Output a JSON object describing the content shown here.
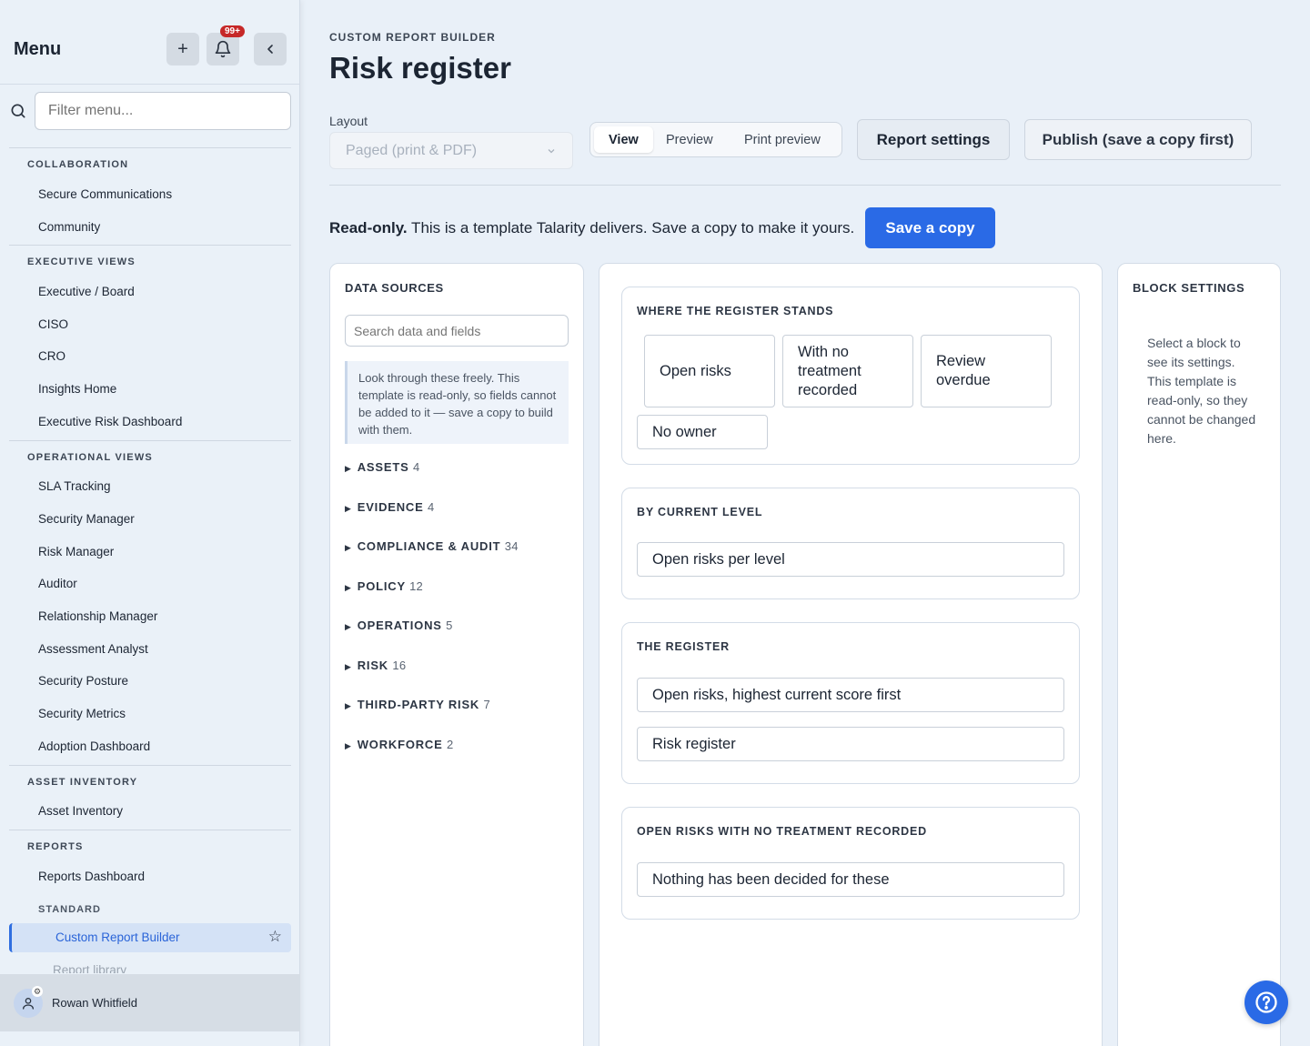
{
  "sidebar": {
    "title": "Menu",
    "notification_count": "99+",
    "filter_placeholder": "Filter menu...",
    "sections": {
      "collaboration": {
        "label": "COLLABORATION",
        "items": [
          "Secure Communications",
          "Community"
        ]
      },
      "executive": {
        "label": "EXECUTIVE VIEWS",
        "items": [
          "Executive / Board",
          "CISO",
          "CRO",
          "Insights Home",
          "Executive Risk Dashboard"
        ]
      },
      "operational": {
        "label": "OPERATIONAL VIEWS",
        "items": [
          "SLA Tracking",
          "Security Manager",
          "Risk Manager",
          "Auditor",
          "Relationship Manager",
          "Assessment Analyst",
          "Security Posture",
          "Security Metrics",
          "Adoption Dashboard"
        ]
      },
      "asset": {
        "label": "ASSET INVENTORY",
        "items": [
          "Asset Inventory"
        ]
      },
      "reports": {
        "label": "REPORTS",
        "items": [
          "Reports Dashboard"
        ],
        "sublabel": "STANDARD",
        "active_item": "Custom Report Builder",
        "next_item": "Report library"
      }
    },
    "user_name": "Rowan Whitfield"
  },
  "header": {
    "eyebrow": "CUSTOM REPORT BUILDER",
    "title": "Risk register",
    "layout_label": "Layout",
    "layout_value": "Paged (print & PDF)",
    "view_modes": [
      "View",
      "Preview",
      "Print preview"
    ],
    "active_view_mode": "View",
    "report_settings": "Report settings",
    "publish": "Publish (save a copy first)"
  },
  "banner": {
    "bold": "Read-only.",
    "text": " This is a template Talarity delivers. Save a copy to make it yours.",
    "save_copy": "Save a copy"
  },
  "data_sources": {
    "title": "DATA SOURCES",
    "search_placeholder": "Search data and fields",
    "note": "Look through these freely. This template is read-only, so fields cannot be added to it — save a copy to build with them.",
    "categories": [
      {
        "name": "ASSETS",
        "count": "4"
      },
      {
        "name": "EVIDENCE",
        "count": "4"
      },
      {
        "name": "COMPLIANCE & AUDIT",
        "count": "34"
      },
      {
        "name": "POLICY",
        "count": "12"
      },
      {
        "name": "OPERATIONS",
        "count": "5"
      },
      {
        "name": "RISK",
        "count": "16"
      },
      {
        "name": "THIRD-PARTY RISK",
        "count": "7"
      },
      {
        "name": "WORKFORCE",
        "count": "2"
      }
    ]
  },
  "canvas": {
    "cards": [
      {
        "title": "WHERE THE REGISTER STANDS",
        "blocks": [
          "Open risks",
          "With no treatment recorded",
          "Review overdue",
          "No owner"
        ]
      },
      {
        "title": "BY CURRENT LEVEL",
        "blocks": [
          "Open risks per level"
        ]
      },
      {
        "title": "THE REGISTER",
        "blocks": [
          "Open risks, highest current score first",
          "Risk register"
        ]
      },
      {
        "title": "OPEN RISKS WITH NO TREATMENT RECORDED",
        "blocks": [
          "Nothing has been decided for these"
        ]
      }
    ]
  },
  "block_settings": {
    "title": "BLOCK SETTINGS",
    "text": "Select a block to see its settings. This template is read-only, so they cannot be changed here."
  },
  "colors": {
    "accent": "#2a6ae6",
    "badge": "#c62828",
    "background": "#e9f0f8"
  }
}
